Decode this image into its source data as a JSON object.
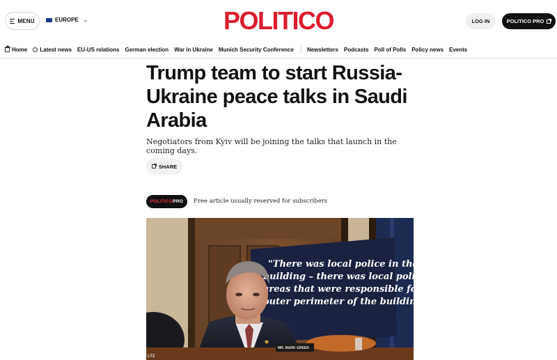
{
  "header": {
    "menu_label": "MENU",
    "edition_label": "EUROPE",
    "logo_text": "POLITICO",
    "login_label": "LOG IN",
    "pro_label": "POLITICO PRO"
  },
  "nav": {
    "items": [
      {
        "label": "Home",
        "icon": "home-icon"
      },
      {
        "label": "Latest news",
        "icon": "clock-icon"
      },
      {
        "label": "EU-US relations"
      },
      {
        "label": "German election"
      },
      {
        "label": "War in Ukraine"
      },
      {
        "label": "Munich Security Conference"
      },
      {
        "label": "Newsletters"
      },
      {
        "label": "Podcasts"
      },
      {
        "label": "Poll of Polls"
      },
      {
        "label": "Policy news"
      },
      {
        "label": "Events"
      }
    ]
  },
  "article": {
    "headline": "Trump team to start Russia-Ukraine peace talks in Saudi Arabia",
    "subhead": "Negotiators from Kyiv will be joining the talks that launch in the coming days.",
    "share_label": "SHARE",
    "pro_badge_part1": "POLITICO",
    "pro_badge_part2": "PRO",
    "free_note": "Free article usually reserved for subscribers"
  },
  "photo": {
    "sign_lines": [
      "\"There was local police in that",
      "building – there was local police in",
      "areas that were responsible for",
      "outer perimeter of the building.\""
    ],
    "nameplate": "MR. MARK GREEN",
    "credit": "LTZ"
  },
  "colors": {
    "brand_red": "#dc1d2e",
    "pro_black": "#111111"
  }
}
